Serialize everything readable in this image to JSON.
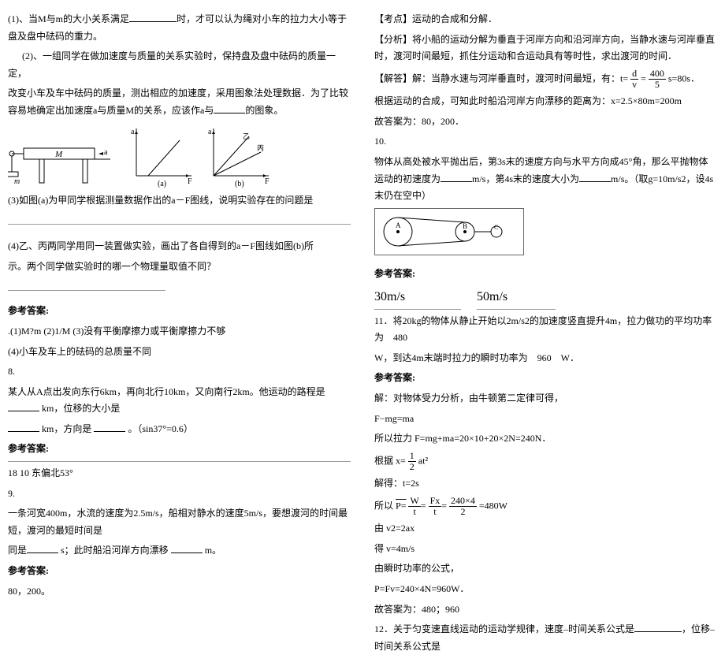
{
  "left": {
    "q7_1": "(1)、当M与m的大小关系满足",
    "q7_1b": "时，才可以认为绳对小车的拉力大小等于盘及盘中砝码的重力。",
    "q7_2": "(2)、一组同学在做加速度与质量的关系实验时，保持盘及盘中砝码的质量一定，",
    "q7_2b": "改变小车及车中砝码的质量，测出相应的加速度，采用图象法处理数据．为了比较容易地确定出加速度a与质量M的关系，应该作a与",
    "q7_2c": "的图象。",
    "fig_a": "(a)",
    "fig_b": "(b)",
    "q7_3": "(3)如图(a)为甲同学根据测量数据作出的a－F图线，说明实验存在的问题是",
    "q7_4": "(4)乙、丙两同学用同一装置做实验，画出了各自得到的a－F图线如图(b)所",
    "q7_4b": "示。两个同学做实验时的哪一个物理量取值不同？",
    "ref": "参考答案:",
    "q7_ans1": ".(1)M?m  (2)1/M  (3)没有平衡摩擦力或平衡摩擦力不够",
    "q7_ans2": "(4)小车及车上的砝码的总质量不同",
    "q8_no": "8.",
    "q8_text": "某人从A点出发向东行6km，再向北行10km，又向南行2km。他运动的路程是",
    "q8_text2": "km，位移的大小是",
    "q8_text3": "km，方向是",
    "q8_text4": "。（sin37°=0.6）",
    "q8_ans": "18  10  东偏北53°",
    "q9_no": "9.",
    "q9_text": "一条河宽400m，水流的速度为2.5m/s，船相对静水的速度5m/s，要想渡河的时间最短，渡河的最短时间是",
    "q9_text2": "s；此时船沿河岸方向漂移",
    "q9_text3": "m。",
    "q9_ans": "80，200。"
  },
  "right": {
    "kd": "【考点】运动的合成和分解．",
    "fx": "【分析】将小船的运动分解为垂直于河岸方向和沿河岸方向，当静水速与河岸垂直时，渡河时间最短，抓住分运动和合运动具有等时性，求出渡河的时间．",
    "jd_label": "【解答】解：当静水速与河岸垂直时，渡河时间最短，有：t=",
    "jd_eq_d": "d",
    "jd_eq_v": "v",
    "jd_eq_400": "400",
    "jd_eq_5": "5",
    "jd_eq_80": "s=80s．",
    "jd2": "根据运动的合成，可知此时船沿河岸方向漂移的距离为：x=2.5×80m=200m",
    "jd3": "故答案为：80，200．",
    "q10_no": "10.",
    "q10_text": "物体从高处被水平抛出后，第3s末的速度方向与水平方向成45°角，那么平抛物体运动的初速度为",
    "q10_text2": "m/s，第4s末的速度大小为",
    "q10_text3": "m/s。（取g=10m/s2，设4s末仍在空中）",
    "q10_ans1": "30m/s",
    "q10_ans2": "50m/s",
    "q11_text1": "11．将20kg的物体从静止开始以2m/s2的加速度竖直提升4m，拉力做功的平均功率为　480",
    "q11_text2": "W，到达4m末端时拉力的瞬时功率为　960　W．",
    "q11_sol1": "解：对物体受力分析，由牛顿第二定律可得，",
    "q11_sol2": "F−mg=ma",
    "q11_sol3": "所以拉力 F=mg+ma=20×10+20×2N=240N．",
    "q11_sol4a": "根据 x=",
    "q11_sol4_1": "1",
    "q11_sol4_2": "2",
    "q11_sol4b": "at²",
    "q11_sol5": "解得：t=2s",
    "q11_sol6a": "所以",
    "q11_sol6_p": "P=",
    "q11_sol6_w": "W",
    "q11_sol6_t": "t",
    "q11_sol6_fx": "Fx",
    "q11_sol6_t2": "t",
    "q11_sol6_240": "240×4",
    "q11_sol6_2": "2",
    "q11_sol6_480": "=480W",
    "q11_sol7": "由 v2=2ax",
    "q11_sol8": "得 v=4m/s",
    "q11_sol9": "由瞬时功率的公式，",
    "q11_sol10": "P=Fv=240×4N=960W．",
    "q11_sol11": "故答案为：480；960",
    "q12_text": "12．关于匀变速直线运动的运动学规律，速度–时间关系公式是",
    "q12_text2": "，位移–时间关系公式是"
  }
}
